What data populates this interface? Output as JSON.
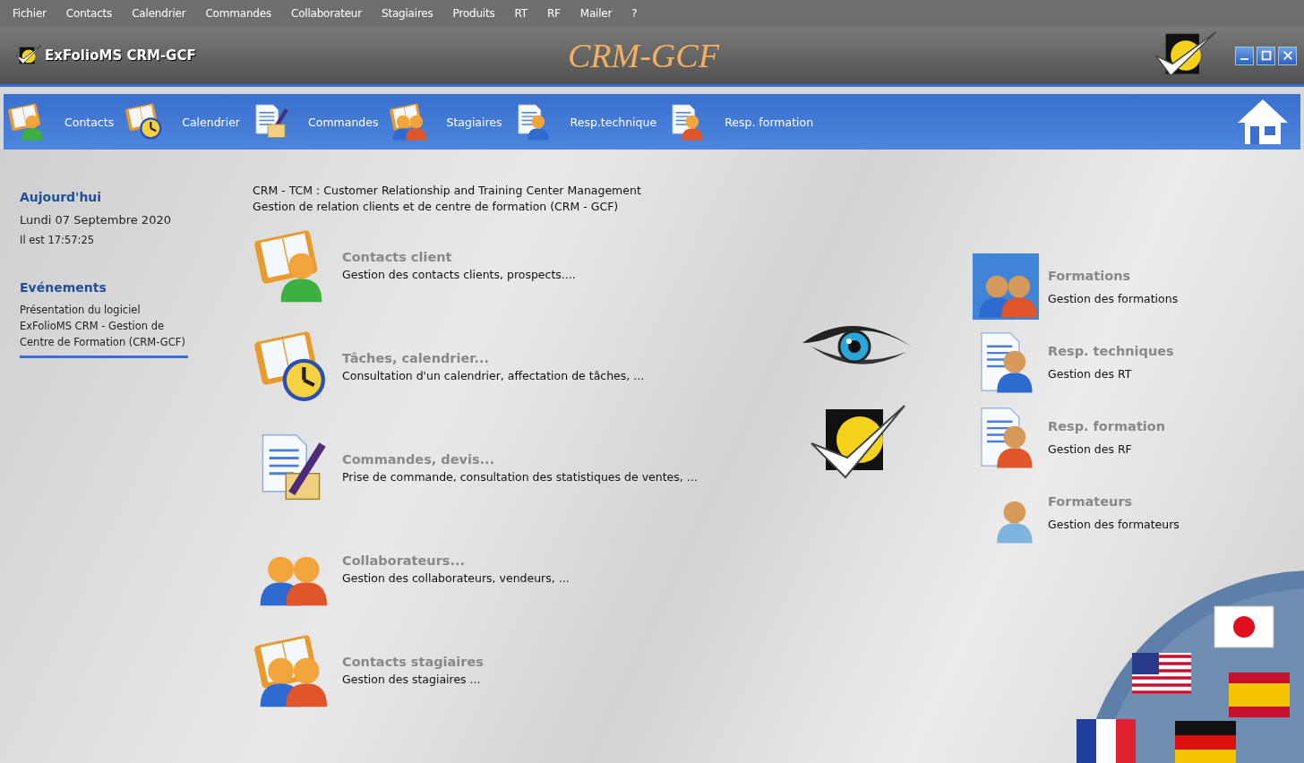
{
  "menu": [
    {
      "label": "Fichier"
    },
    {
      "label": "Contacts"
    },
    {
      "label": "Calendrier"
    },
    {
      "label": "Commandes"
    },
    {
      "label": "Collaborateur"
    },
    {
      "label": "Stagiaires"
    },
    {
      "label": "Produits"
    },
    {
      "label": "RT"
    },
    {
      "label": "RF"
    },
    {
      "label": "Mailer"
    },
    {
      "label": "?"
    }
  ],
  "header": {
    "app_title": "ExFolioMS CRM-GCF",
    "logo_text": "CRM-GCF"
  },
  "toolbar": [
    {
      "label": "Contacts"
    },
    {
      "label": "Calendrier"
    },
    {
      "label": "Commandes"
    },
    {
      "label": "Stagiaires"
    },
    {
      "label": "Resp.technique"
    },
    {
      "label": "Resp. formation"
    }
  ],
  "today": {
    "heading": "Aujourd'hui",
    "date": "Lundi 07 Septembre 2020",
    "time": "Il est 17:57:25"
  },
  "events": {
    "heading": "Evénements",
    "text": "Présentation du logiciel ExFolioMS CRM - Gestion de Centre de Formation (CRM-GCF)"
  },
  "intro": [
    "CRM - TCM : Customer Relationship and Training Center Management",
    "Gestion de relation clients et de centre de formation (CRM - GCF)"
  ],
  "modules": [
    {
      "title": "Contacts client",
      "description": "Gestion des contacts clients, prospects...."
    },
    {
      "title": "Tâches, calendrier...",
      "description": "Consultation d'un calendrier, affectation de tâches, ..."
    },
    {
      "title": "Commandes, devis...",
      "description": "Prise de commande, consultation des statistiques de ventes, ..."
    },
    {
      "title": "Collaborateurs...",
      "description": "Gestion des collaborateurs, vendeurs, ..."
    },
    {
      "title": "Contacts stagiaires",
      "description": "Gestion des stagiaires ..."
    }
  ],
  "right_modules": [
    {
      "title": "Formations",
      "description": "Gestion des formations"
    },
    {
      "title": "Resp. techniques",
      "description": "Gestion des RT"
    },
    {
      "title": "Resp. formation",
      "description": "Gestion des RF"
    },
    {
      "title": "Formateurs",
      "description": "Gestion des formateurs"
    }
  ]
}
